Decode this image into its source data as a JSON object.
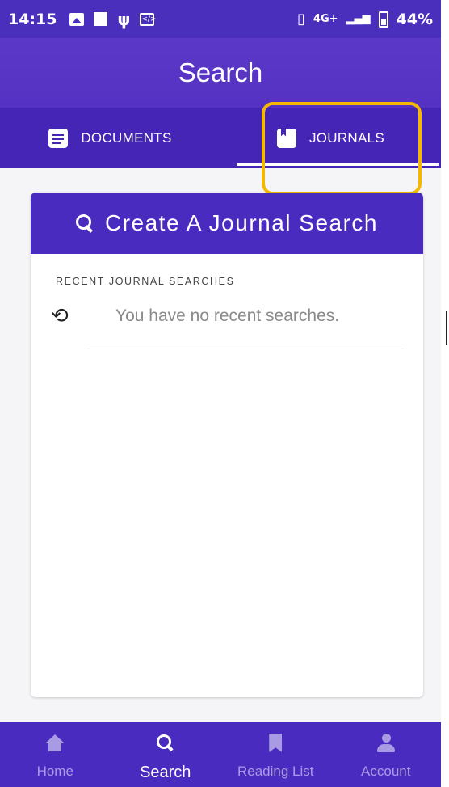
{
  "status_bar": {
    "time": "14:15",
    "network": "4G+",
    "battery": "44%",
    "icons": [
      "gallery-icon",
      "square-icon",
      "usb-icon",
      "code-icon",
      "vibrate-icon",
      "signal-icon",
      "battery-icon"
    ]
  },
  "app_bar": {
    "title": "Search"
  },
  "tabs": [
    {
      "label": "DOCUMENTS",
      "icon": "document-icon",
      "active": false
    },
    {
      "label": "JOURNALS",
      "icon": "book-icon",
      "active": true
    }
  ],
  "main": {
    "create_button_label": "Create A Journal Search",
    "recent_title": "RECENT JOURNAL SEARCHES",
    "empty_message": "You have no recent searches."
  },
  "bottom_nav": [
    {
      "label": "Home",
      "icon": "home-icon",
      "active": false
    },
    {
      "label": "Search",
      "icon": "search-icon",
      "active": true
    },
    {
      "label": "Reading List",
      "icon": "bookmark-icon",
      "active": false
    },
    {
      "label": "Account",
      "icon": "account-icon",
      "active": false
    }
  ],
  "colors": {
    "primary": "#4a2bbf",
    "app_bar": "#5632c3",
    "tab_bar": "#4525b5",
    "highlight": "#f5b800",
    "inactive_nav": "#a99be3"
  }
}
